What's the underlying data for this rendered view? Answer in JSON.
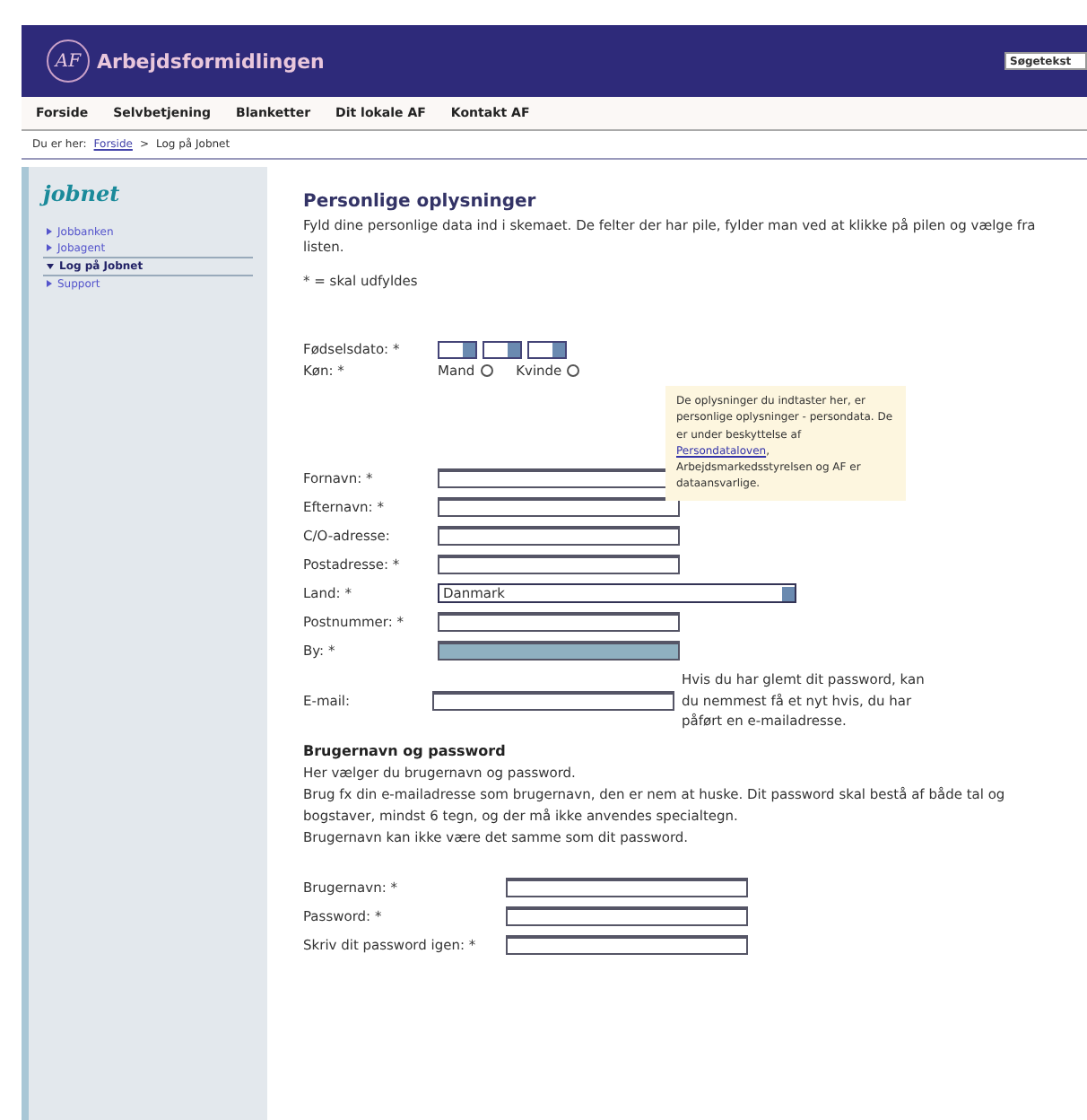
{
  "header": {
    "logo": "AF",
    "title": "Arbejdsformidlingen",
    "search": {
      "placeholder": "Søgetekst"
    }
  },
  "nav": [
    "Forside",
    "Selvbetjening",
    "Blanketter",
    "Dit lokale AF",
    "Kontakt AF"
  ],
  "breadcrumb": {
    "prefix": "Du er her:",
    "link": "Forside",
    "separator": ">",
    "current": "Log på Jobnet"
  },
  "sidebar": {
    "title": "jobnet",
    "items": [
      {
        "label": "Jobbanken",
        "selected": false
      },
      {
        "label": "Jobagent",
        "selected": false
      },
      {
        "label": "Log på Jobnet",
        "selected": true
      },
      {
        "label": "Support",
        "selected": false
      }
    ]
  },
  "heading": "Personlige oplysninger",
  "intro": "Fyld dine personlige data ind i skemaet. De felter der har pile, fylder man ved at klikke på pilen og vælge fra listen.",
  "required_note": "* = skal udfyldes",
  "birthdate": {
    "label": "Fødselsdato: *"
  },
  "gender": {
    "label": "Køn: *",
    "options": [
      {
        "label": "Mand",
        "selected": false
      },
      {
        "label": "Kvinde",
        "selected": false
      }
    ]
  },
  "tooltip": {
    "before": "De oplysninger du indtaster her, er personlige oplysninger - persondata. De er under beskyttelse af ",
    "link": "Persondataloven",
    "after": ", Arbejdsmarkedsstyrelsen og AF er dataansvarlige."
  },
  "fields": [
    {
      "label": "Fornavn: *",
      "kind": "text"
    },
    {
      "label": "Efternavn: *",
      "kind": "text"
    },
    {
      "label": "C/O-adresse:",
      "kind": "text"
    },
    {
      "label": "Postadresse: *",
      "kind": "text"
    },
    {
      "label": "Land: *",
      "kind": "select",
      "value": "Danmark"
    },
    {
      "label": "Postnummer: *",
      "kind": "text"
    },
    {
      "label": "By: *",
      "kind": "filled"
    },
    {
      "label": "E-mail:",
      "kind": "text",
      "note": "Hvis du har glemt dit password, kan du nemmest få et nyt hvis, du har påført en e-mailadresse."
    }
  ],
  "account": {
    "heading": "Brugernavn og password",
    "lines": [
      "Her vælger du brugernavn og password.",
      "Brug fx din e-mailadresse som brugernavn, den er nem at huske. Dit password skal bestå af både tal og bogstaver, mindst 6 tegn, og der må ikke anvendes specialtegn.",
      "Brugernavn kan ikke være det samme som dit password."
    ],
    "fields": [
      {
        "label": "Brugernavn: *"
      },
      {
        "label": "Password: *"
      },
      {
        "label": "Skriv dit password igen: *"
      }
    ]
  }
}
